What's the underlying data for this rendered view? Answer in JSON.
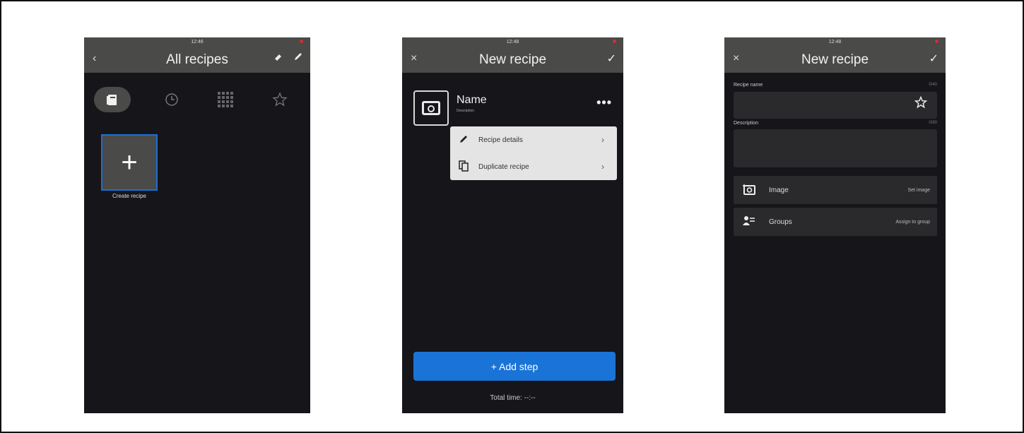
{
  "screen1": {
    "status_time": "12:46",
    "back_icon": "‹",
    "title": "All recipes",
    "tool_icons": [
      "eraser-icon",
      "pencil-icon"
    ],
    "tabs": [
      {
        "name": "tab-recipes",
        "icon": "book-icon",
        "active": true
      },
      {
        "name": "tab-history",
        "icon": "clock-icon",
        "active": false
      },
      {
        "name": "tab-grid",
        "icon": "grid-icon",
        "active": false
      },
      {
        "name": "tab-favorites",
        "icon": "star-icon",
        "active": false
      }
    ],
    "create_plus": "+",
    "create_label": "Create recipe"
  },
  "screen2": {
    "status_time": "12:48",
    "close_icon": "×",
    "title": "New recipe",
    "confirm_icon": "✓",
    "name": "Name",
    "description": "Description",
    "more_icon": "•••",
    "menu": [
      {
        "icon": "pencil-icon",
        "label": "Recipe details",
        "chevron": "›"
      },
      {
        "icon": "copy-icon",
        "label": "Duplicate recipe",
        "chevron": "›"
      }
    ],
    "add_step_label": "+ Add step",
    "total_time": "Total time: --:--"
  },
  "screen3": {
    "status_time": "12:48",
    "close_icon": "×",
    "title": "New recipe",
    "confirm_icon": "✓",
    "recipe_name_label": "Recipe name",
    "recipe_name_count": "0/40",
    "recipe_name_value": "",
    "description_label": "Description",
    "description_count": "0/80",
    "description_value": "",
    "image_label": "Image",
    "image_action": "Set image",
    "groups_label": "Groups",
    "groups_action": "Assign to group"
  },
  "colors": {
    "app_bg": "#16151a",
    "bar_bg": "#4a4a48",
    "accent": "#1a73d6",
    "status_dot": "#d32f2f"
  }
}
